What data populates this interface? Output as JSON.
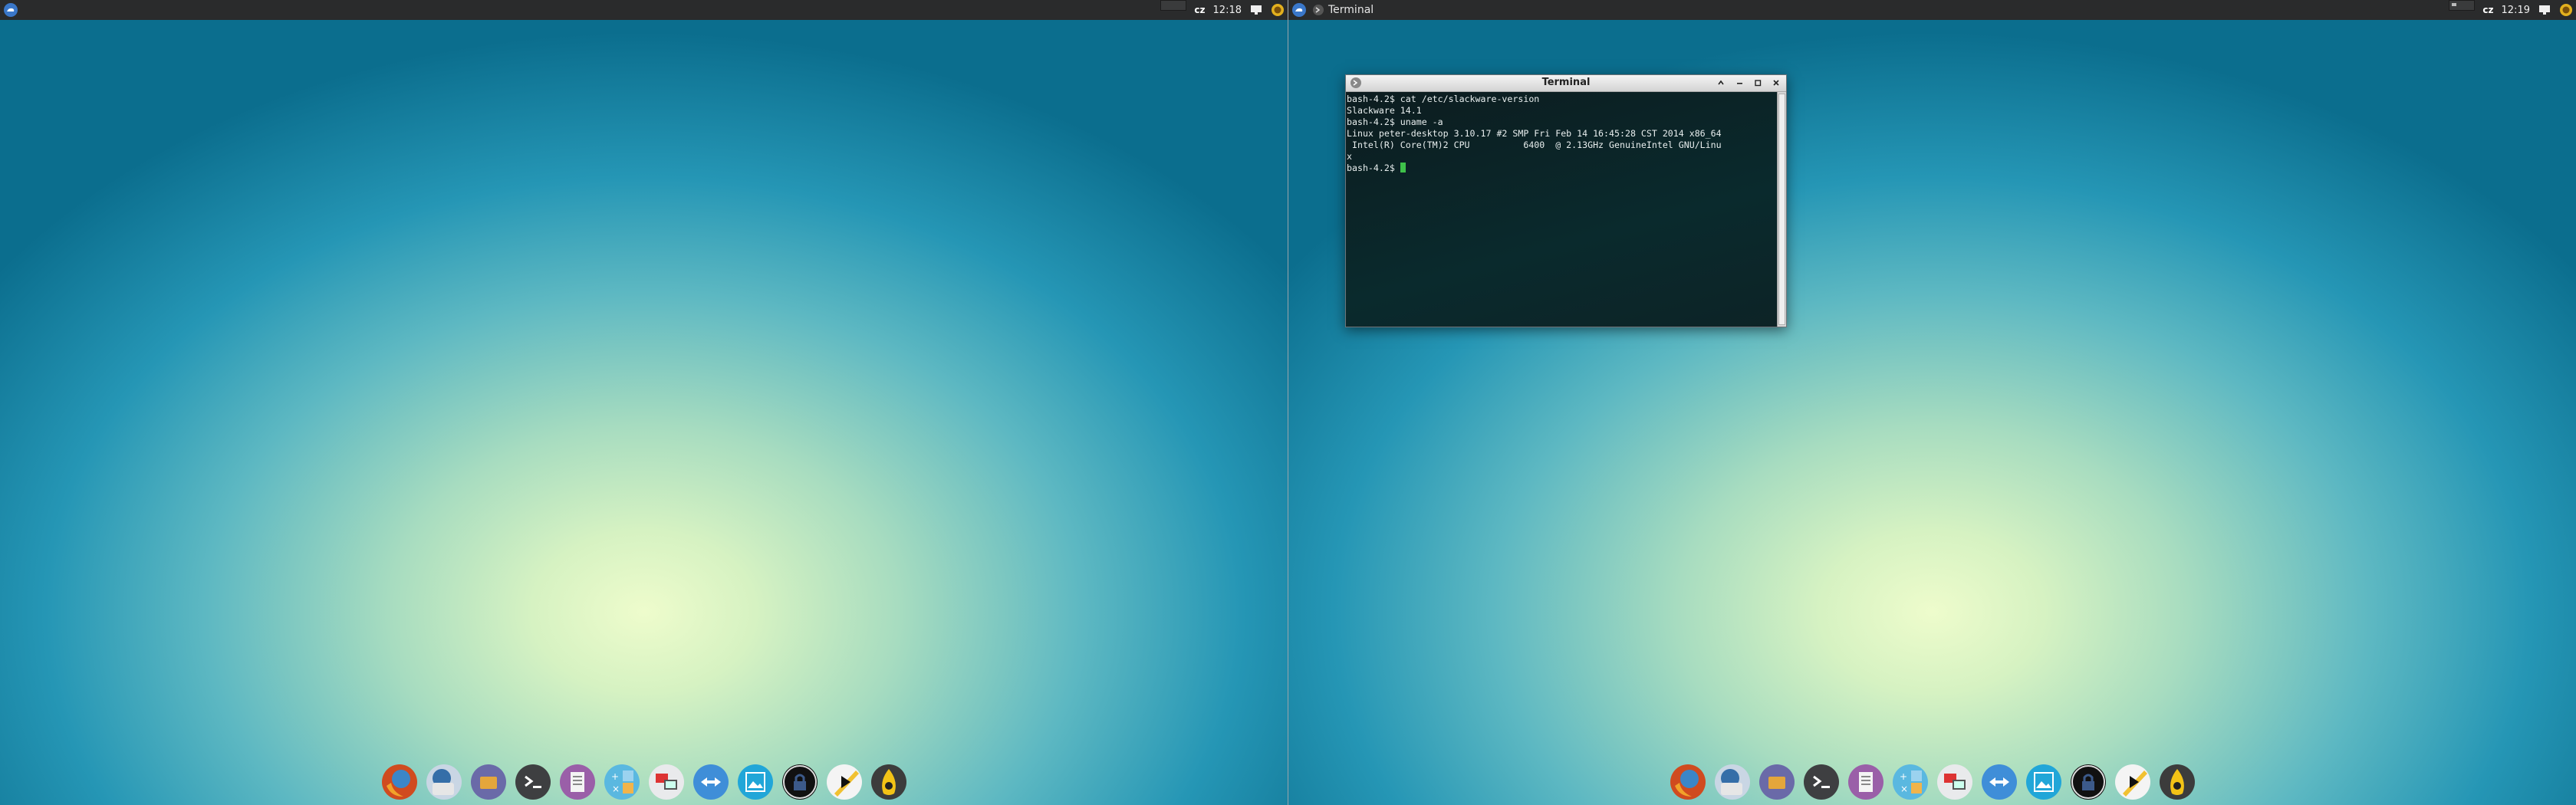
{
  "left_screen": {
    "panel": {
      "keyboard_layout": "cz",
      "clock": "12:18"
    }
  },
  "right_screen": {
    "panel": {
      "active_task": "Terminal",
      "keyboard_layout": "cz",
      "clock": "12:19"
    },
    "terminal": {
      "title": "Terminal",
      "lines": [
        "bash-4.2$ cat /etc/slackware-version",
        "Slackware 14.1",
        "bash-4.2$ uname -a",
        "Linux peter-desktop 3.10.17 #2 SMP Fri Feb 14 16:45:28 CST 2014 x86_64",
        " Intel(R) Core(TM)2 CPU          6400  @ 2.13GHz GenuineIntel GNU/Linu",
        "x"
      ],
      "prompt": "bash-4.2$ ",
      "cursor_color": "#3ec14a"
    }
  },
  "dock_icons": [
    "firefox-icon",
    "thunderbird-icon",
    "file-manager-icon",
    "terminal-icon",
    "text-editor-icon",
    "calculator-icon",
    "remote-desktop-icon",
    "network-icon",
    "image-viewer-icon",
    "lock-screen-icon",
    "media-player-icon",
    "audio-player-icon"
  ]
}
